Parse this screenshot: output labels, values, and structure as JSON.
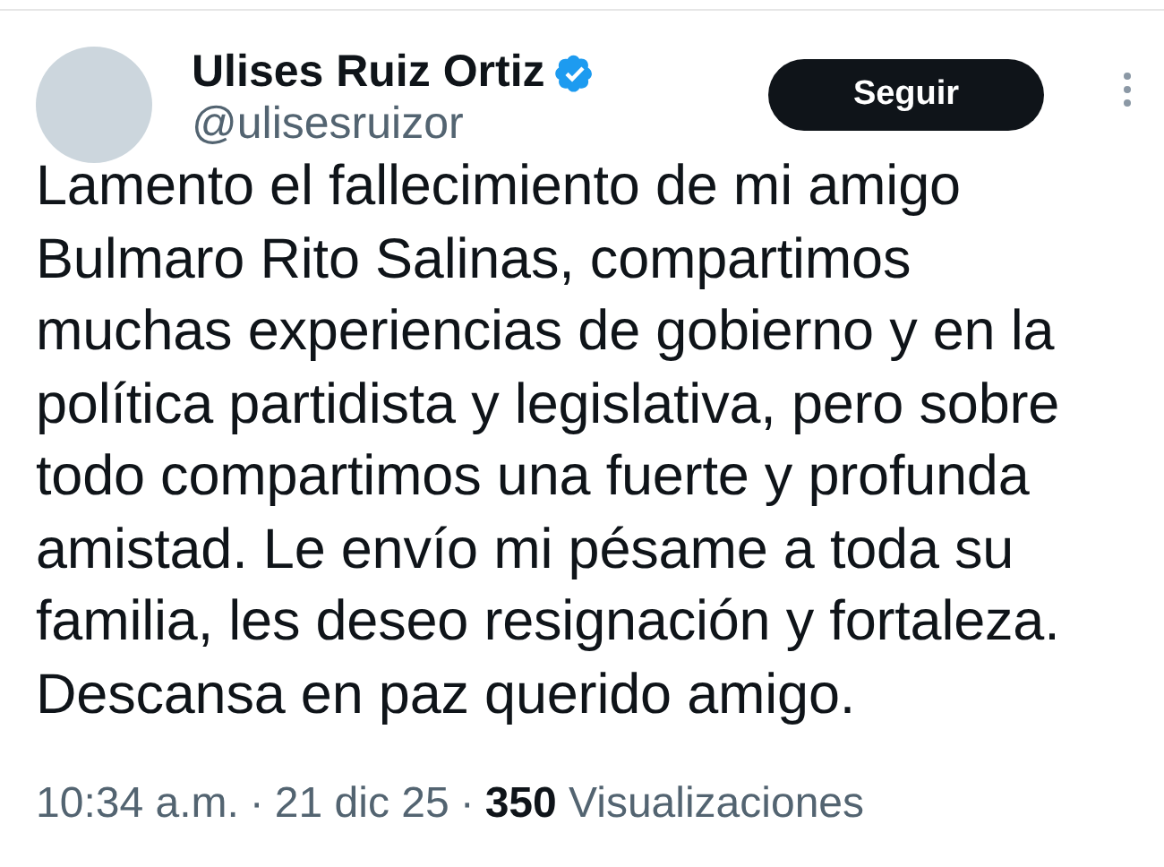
{
  "author": {
    "name": "Ulises Ruiz Ortiz",
    "verified": true,
    "handle": "@ulisesruizor"
  },
  "follow_button": "Seguir",
  "text_lines": [
    "Lamento el fallecimiento de mi amigo",
    "Bulmaro Rito Salinas, compartimos",
    "muchas experiencias de gobierno y en la",
    "política partidista y legislativa, pero sobre",
    "todo compartimos una fuerte y profunda",
    "amistad. Le envío mi pésame a toda su",
    "familia, les deseo resignación y fortaleza.",
    "Descansa en paz querido amigo."
  ],
  "meta": {
    "time": "10:34 a.m.",
    "separator": "·",
    "date": "21 dic 25",
    "views_count": "350",
    "views_label": "Visualizaciones"
  }
}
